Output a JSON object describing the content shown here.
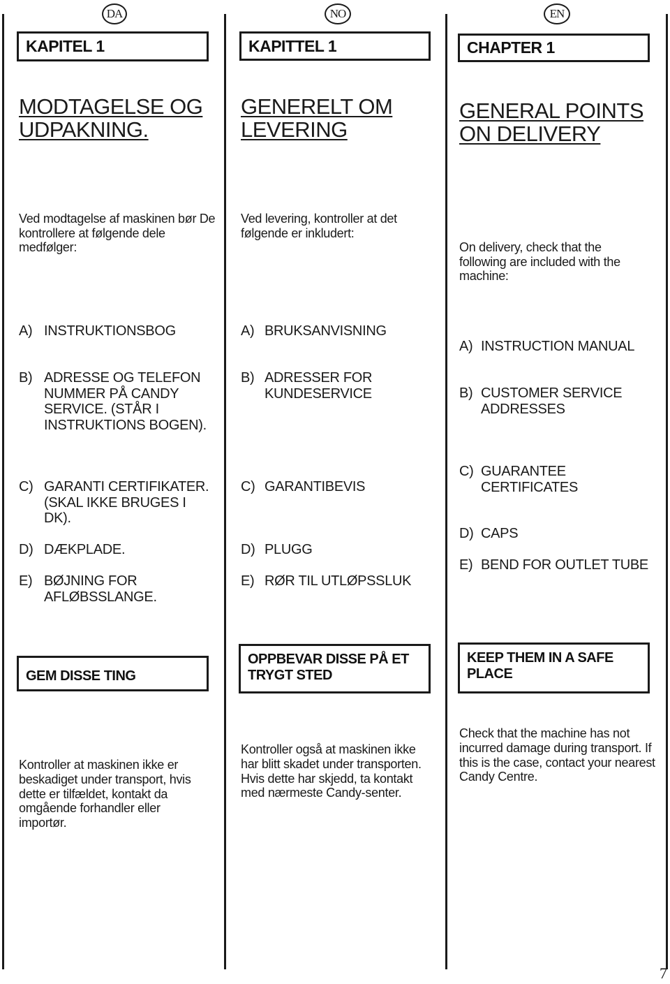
{
  "columns": [
    {
      "lang_code": "DA",
      "chapter": "KAPITEL 1",
      "heading_lines": [
        "MODTAGELSE OG",
        "UDPAKNING."
      ],
      "intro": "Ved modtagelse af maskinen bør De kontrollere at følgende dele medfølger:",
      "items": [
        {
          "label": "A)",
          "text": "INSTRUKTIONSBOG"
        },
        {
          "label": "B)",
          "text": "ADRESSE OG TELEFON NUMMER PÅ CANDY SERVICE. (STÅR I INSTRUKTIONS BOGEN)."
        },
        {
          "label": "C)",
          "text": "GARANTI CERTIFIKATER. (SKAL IKKE BRUGES I DK)."
        },
        {
          "label": "D)",
          "text": "DÆKPLADE."
        },
        {
          "label": "E)",
          "text": "BØJNING FOR AFLØBSSLANGE."
        }
      ],
      "safe_note": "GEM DISSE TING",
      "check_text": "Kontroller at maskinen ikke er beskadiget under transport, hvis dette er tilfældet, kontakt da omgående forhandler eller importør."
    },
    {
      "lang_code": "NO",
      "chapter": "KAPITTEL 1",
      "heading_lines": [
        "GENERELT OM",
        "LEVERING"
      ],
      "intro": "Ved levering, kontroller at det følgende er inkludert:",
      "items": [
        {
          "label": "A)",
          "text": "BRUKSANVISNING"
        },
        {
          "label": "B)",
          "text": "ADRESSER FOR KUNDESERVICE"
        },
        {
          "label": "C)",
          "text": "GARANTIBEVIS"
        },
        {
          "label": "D)",
          "text": "PLUGG"
        },
        {
          "label": "E)",
          "text": "RØR TIL UTLØPSSLUK"
        }
      ],
      "safe_note": "OPPBEVAR DISSE PÅ ET TRYGT STED",
      "check_text": "Kontroller også at maskinen ikke har blitt skadet under transporten. Hvis dette har skjedd, ta kontakt med nærmeste Candy-senter."
    },
    {
      "lang_code": "EN",
      "chapter": "CHAPTER 1",
      "heading_lines": [
        "GENERAL POINTS",
        "ON DELIVERY"
      ],
      "intro": "On delivery, check that the following are included with the machine:",
      "items": [
        {
          "label": "A)",
          "text": "INSTRUCTION MANUAL"
        },
        {
          "label": "B)",
          "text": "CUSTOMER SERVICE ADDRESSES"
        },
        {
          "label": "C)",
          "text": "GUARANTEE CERTIFICATES"
        },
        {
          "label": "D)",
          "text": "CAPS"
        },
        {
          "label": "E)",
          "text": "BEND FOR OUTLET TUBE"
        }
      ],
      "safe_note": "KEEP THEM IN A SAFE PLACE",
      "check_text": "Check that the machine has not incurred damage during transport. If this is the case, contact your nearest Candy Centre."
    }
  ],
  "page_number": "7"
}
